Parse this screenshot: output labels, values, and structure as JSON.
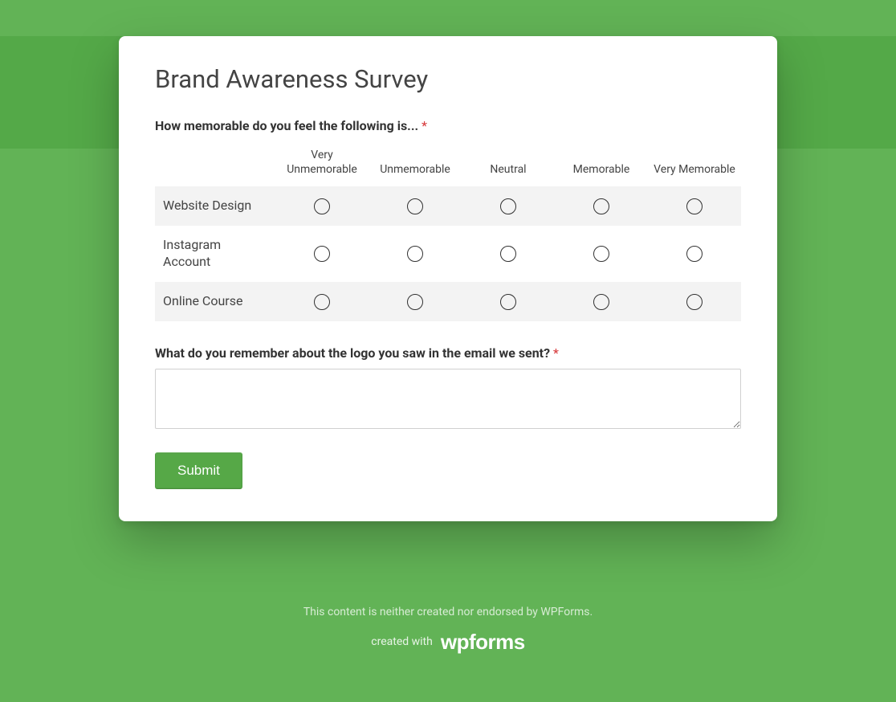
{
  "title": "Brand Awareness Survey",
  "question1": {
    "label": "How memorable do you feel the following is...",
    "required_marker": "*",
    "columns": [
      "Very Unmemorable",
      "Unmemorable",
      "Neutral",
      "Memorable",
      "Very Memorable"
    ],
    "rows": [
      "Website Design",
      "Instagram Account",
      "Online Course"
    ]
  },
  "question2": {
    "label": "What do you remember about the logo you saw in the email we sent?",
    "required_marker": "*",
    "value": ""
  },
  "submit_label": "Submit",
  "footer": {
    "disclaimer": "This content is neither created nor endorsed by WPForms.",
    "created_with": "created with",
    "brand": "wpforms"
  }
}
